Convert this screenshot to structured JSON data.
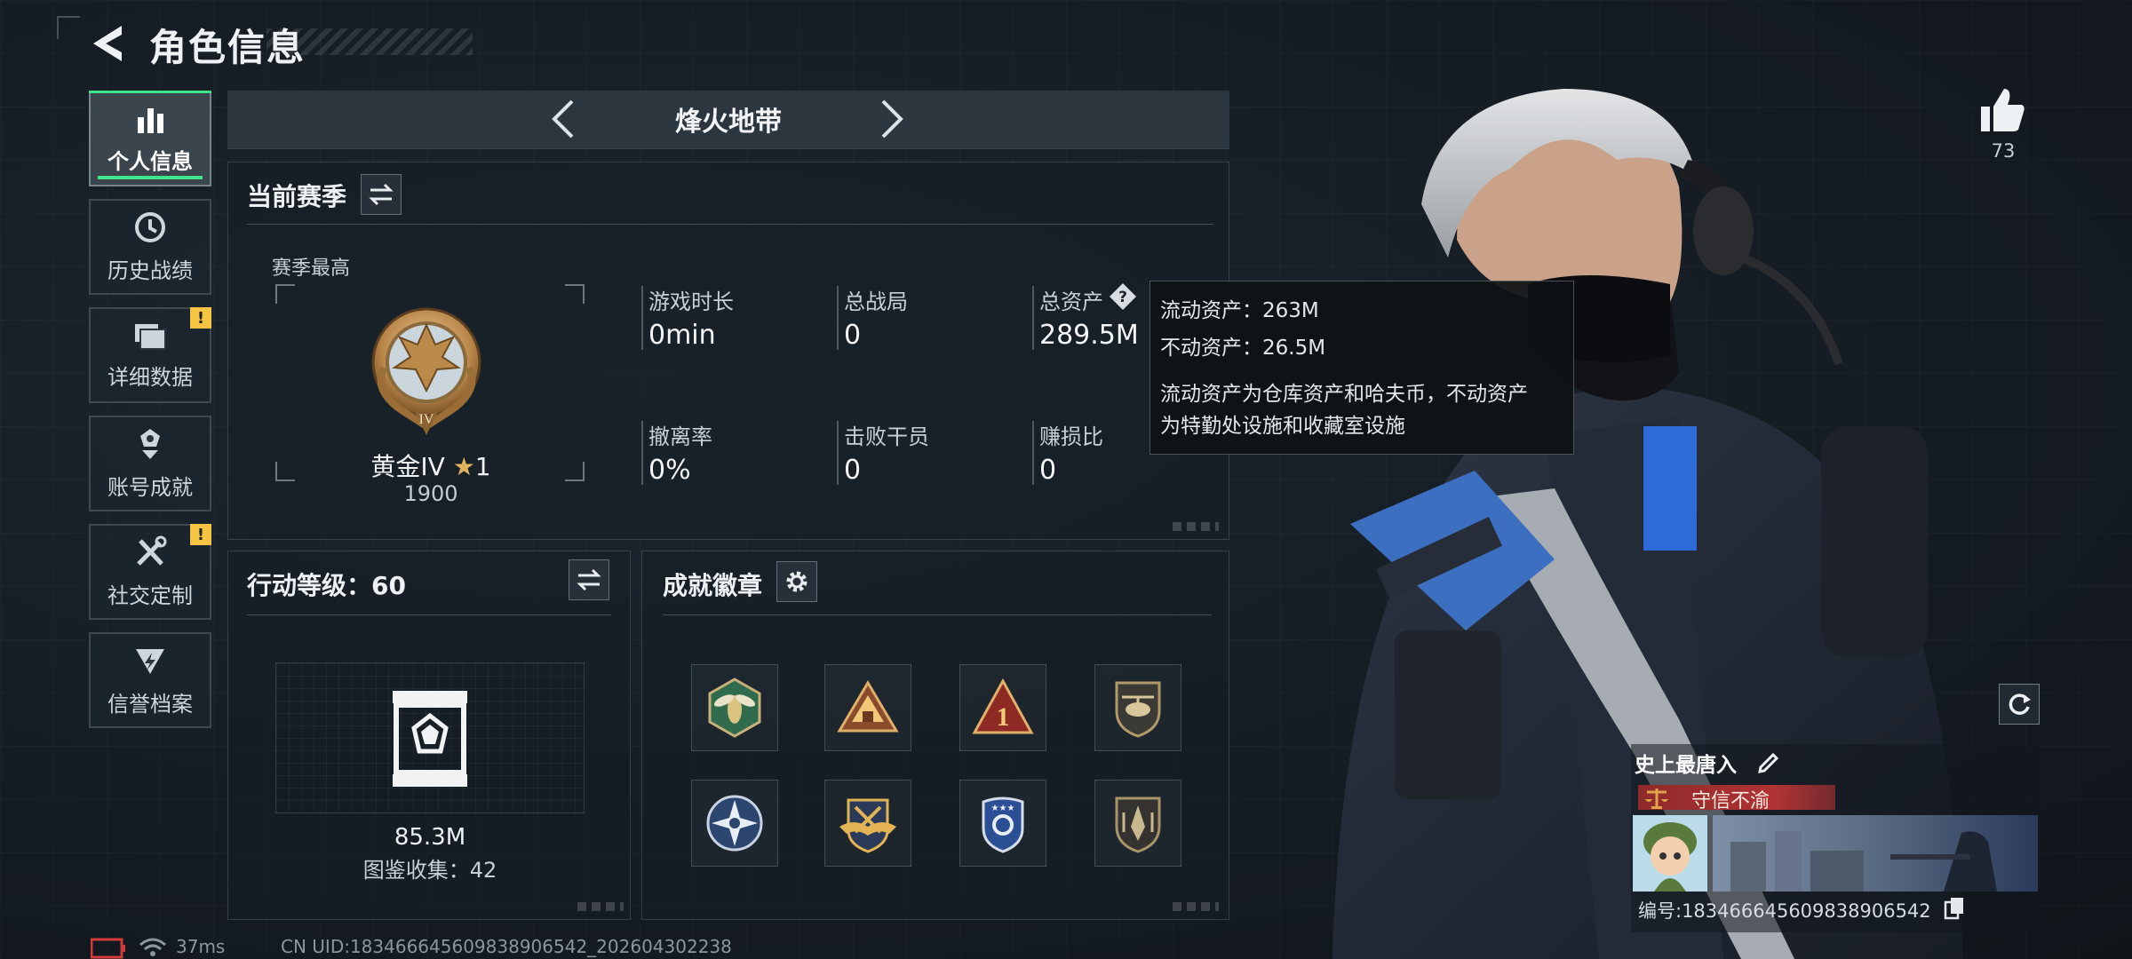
{
  "header": {
    "title": "角色信息"
  },
  "sidebar": {
    "items": [
      {
        "label": "个人信息",
        "icon": "bar-chart-icon",
        "active": true
      },
      {
        "label": "历史战绩",
        "icon": "history-clock-icon"
      },
      {
        "label": "详细数据",
        "icon": "folder-icon",
        "warning": "!"
      },
      {
        "label": "账号成就",
        "icon": "achievement-icon"
      },
      {
        "label": "社交定制",
        "icon": "tools-icon",
        "warning": "!"
      },
      {
        "label": "信誉档案",
        "icon": "credibility-icon"
      }
    ]
  },
  "mode": {
    "title": "烽火地带"
  },
  "season": {
    "title": "当前赛季",
    "best_label": "赛季最高",
    "rank_name": "黄金IV",
    "rank_stars": "1",
    "rank_score": "1900",
    "stats": [
      {
        "label": "游戏时长",
        "value": "0min"
      },
      {
        "label": "总战局",
        "value": "0"
      },
      {
        "label": "总资产",
        "value": "289.5M"
      },
      {
        "label": "撤离率",
        "value": "0%"
      },
      {
        "label": "击败干员",
        "value": "0"
      },
      {
        "label": "赚损比",
        "value": "0"
      }
    ]
  },
  "tooltip": {
    "liquid": "流动资产：263M",
    "fixed": "不动资产：26.5M",
    "desc_line1": "流动资产为仓库资产和哈夫币，不动资产",
    "desc_line2": "为特勤处设施和收藏室设施"
  },
  "action_level": {
    "title": "行动等级：60",
    "value": "85.3M",
    "collection": "图鉴收集：42"
  },
  "badges": {
    "title": "成就徽章",
    "items": [
      "hornet-badge-icon",
      "tent-badge-icon",
      "number-one-badge-icon",
      "helicopter-badge-icon",
      "star-compass-badge-icon",
      "gold-wings-badge-icon",
      "police-badge-icon",
      "shield-badge-icon"
    ]
  },
  "like": {
    "count": "73"
  },
  "card": {
    "name": "史上最唐入",
    "honor": "守信不渝",
    "id_label": "编号:1834666456098389065​42"
  },
  "footer": {
    "ping": "37ms",
    "uid": "CN UID:1834666456098389065​42_202604302238"
  },
  "colors": {
    "accent_green": "#3fe48a",
    "warning_yellow": "#f5c542",
    "honor_red": "#b03333"
  }
}
